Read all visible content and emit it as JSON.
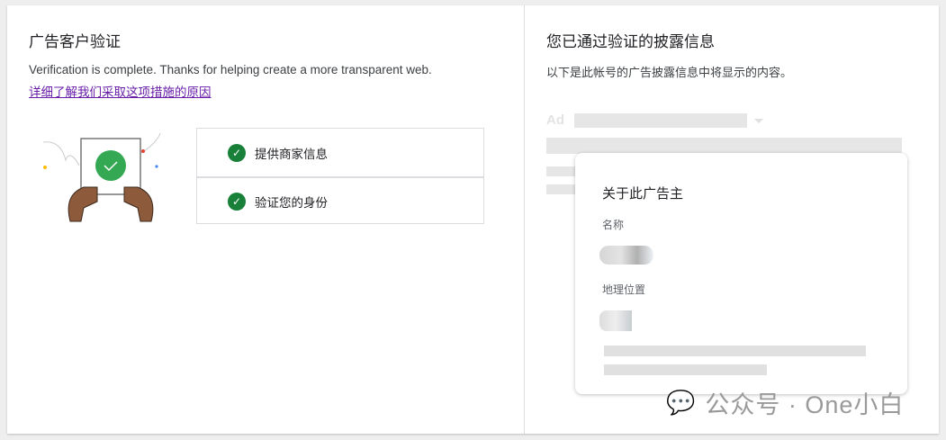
{
  "left": {
    "title": "广告客户验证",
    "message": "Verification is complete. Thanks for helping create a more transparent web.",
    "learn_more_link": "详细了解我们采取这项措施的原因",
    "steps": [
      {
        "label": "提供商家信息",
        "status": "complete"
      },
      {
        "label": "验证您的身份",
        "status": "complete"
      }
    ]
  },
  "right": {
    "title": "您已通过验证的披露信息",
    "subtitle": "以下是此帐号的广告披露信息中将显示的内容。",
    "ad_label": "Ad",
    "popup": {
      "title": "关于此广告主",
      "name_label": "名称",
      "location_label": "地理位置"
    }
  },
  "watermark": "公众号 · One小白",
  "colors": {
    "check_green": "#188038",
    "link": "#681da8"
  }
}
